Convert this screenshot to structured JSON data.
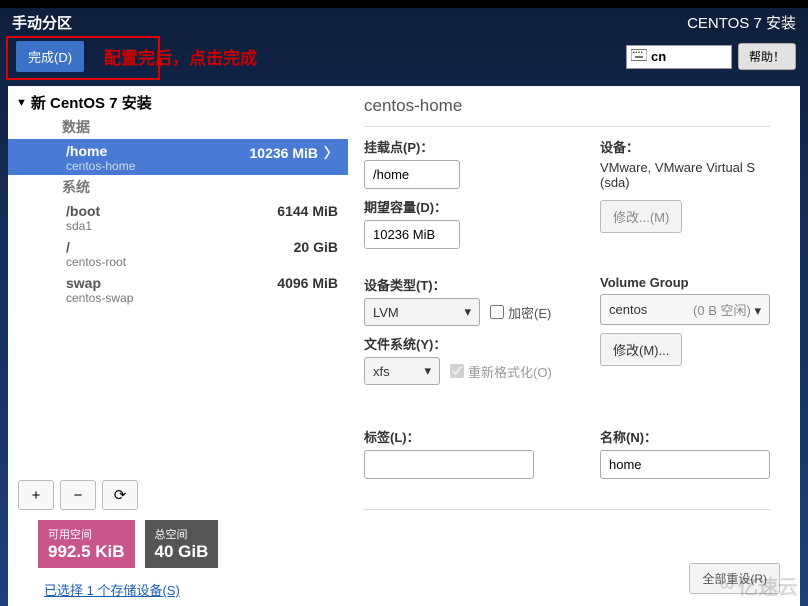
{
  "header": {
    "title": "手动分区",
    "installer": "CENTOS 7 安装"
  },
  "subheader": {
    "done": "完成(D)",
    "tip": "配置完后，点击完成",
    "lang": "cn",
    "help": "帮助！"
  },
  "tree": {
    "title": "新 CentOS 7 安装",
    "sections": {
      "data": "数据",
      "system": "系统"
    },
    "partitions": [
      {
        "mount": "/home",
        "dev": "centos-home",
        "size": "10236 MiB",
        "section": "data",
        "selected": true
      },
      {
        "mount": "/boot",
        "dev": "sda1",
        "size": "6144 MiB",
        "section": "system"
      },
      {
        "mount": "/",
        "dev": "centos-root",
        "size": "20 GiB",
        "section": "system"
      },
      {
        "mount": "swap",
        "dev": "centos-swap",
        "size": "4096 MiB",
        "section": "system"
      }
    ]
  },
  "toolbar": {
    "add": "+",
    "remove": "−",
    "reload": "⟳"
  },
  "disks": {
    "avail": {
      "label": "可用空间",
      "value": "992.5 KiB"
    },
    "total": {
      "label": "总空间",
      "value": "40 GiB"
    }
  },
  "storage_link": "已选择 1 个存储设备(S)",
  "details": {
    "title": "centos-home",
    "mount_label": "挂载点(P)：",
    "mount_value": "/home",
    "capacity_label": "期望容量(D)：",
    "capacity_value": "10236 MiB",
    "device_label": "设备：",
    "device_value": "VMware, VMware Virtual S (sda)",
    "modify": "修改...(M)",
    "devtype_label": "设备类型(T)：",
    "devtype_value": "LVM",
    "encrypt": "加密(E)",
    "fs_label": "文件系统(Y)：",
    "fs_value": "xfs",
    "reformat": "重新格式化(O)",
    "vg_label": "Volume Group",
    "vg_value": "centos",
    "vg_free": "(0 B 空闲)",
    "modify2": "修改(M)...",
    "tag_label": "标签(L)：",
    "tag_value": "",
    "name_label": "名称(N)：",
    "name_value": "home",
    "reset": "全部重设(R)"
  },
  "watermark": "亿速云"
}
